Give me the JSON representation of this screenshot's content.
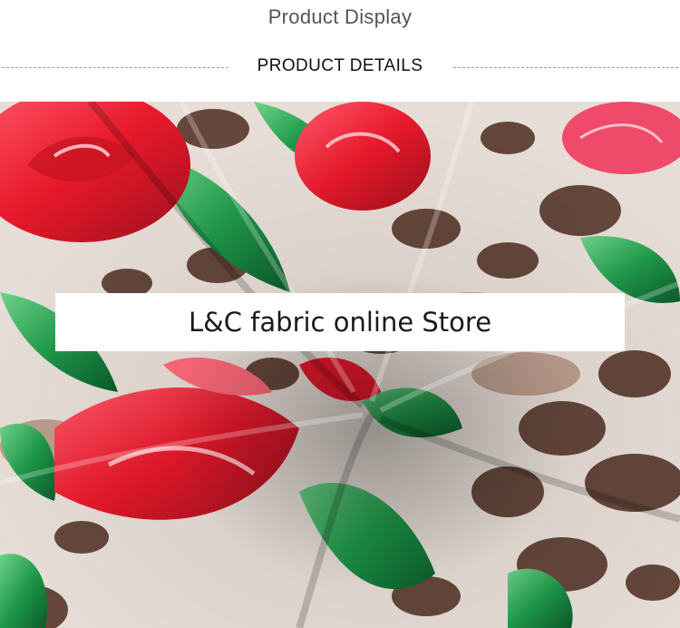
{
  "header": {
    "title": "Product Display",
    "section_title": "PRODUCT DETAILS"
  },
  "photo": {
    "subject": "draped floral leopard print fabric",
    "banner_text": "L&C fabric online Store"
  },
  "colors": {
    "rose_red": "#e8192c",
    "leaf_green": "#1f9a4a",
    "leopard_brown": "#5a3a2e",
    "base_cream": "#e6ddd6"
  }
}
